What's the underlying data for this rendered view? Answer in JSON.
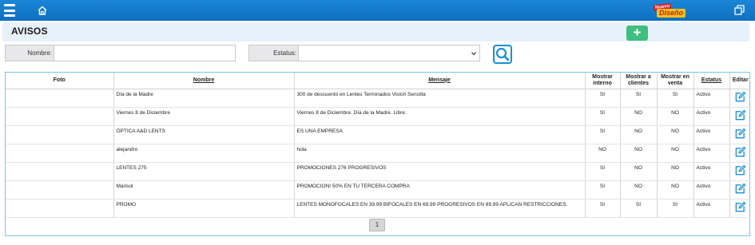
{
  "topbar": {
    "logo_top": "Nuevo",
    "logo_bottom": "Diseño"
  },
  "page": {
    "title": "AVISOS",
    "add_label": "+"
  },
  "filters": {
    "nombre_label": "Nombre:",
    "nombre_value": "",
    "estatus_label": "Estatus:",
    "estatus_value": ""
  },
  "table": {
    "headers": {
      "foto": "Foto",
      "nombre": "Nombre",
      "mensaje": "Mensaje",
      "mostrar_interno": "Mostrar interno",
      "mostrar_clientes": "Mostrar a clientes",
      "mostrar_venta": "Mostrar en venta",
      "estatus": "Estatus",
      "editar": "Editar"
    },
    "rows": [
      {
        "nombre": "Día de la Madre",
        "mensaje": "300 de descuento en Lentes Terminados Vision Sencilla",
        "interno": "SI",
        "clientes": "SI",
        "venta": "SI",
        "estatus": "Activo"
      },
      {
        "nombre": "Viernes 8 de Diciembre",
        "mensaje": "Viernes 8 de Diciembre. Día de la Madre. Libre.",
        "interno": "SI",
        "clientes": "NO",
        "venta": "NO",
        "estatus": "Activo"
      },
      {
        "nombre": "ÓPTICA A&D LENTS",
        "mensaje": "ES UNA EMPRESA",
        "interno": "SI",
        "clientes": "NO",
        "venta": "NO",
        "estatus": "Activo"
      },
      {
        "nombre": "alejandro",
        "mensaje": "hola",
        "interno": "NO",
        "clientes": "NO",
        "venta": "NO",
        "estatus": "Activo"
      },
      {
        "nombre": "LENTES 275",
        "mensaje": "PROMOCIONES 276 PROGRESIVOS",
        "interno": "SI",
        "clientes": "NO",
        "venta": "NO",
        "estatus": "Activo"
      },
      {
        "nombre": "Marisol",
        "mensaje": "PROMOCION! 50% EN TU TERCERA COMPRA",
        "interno": "SI",
        "clientes": "NO",
        "venta": "NO",
        "estatus": "Activo"
      },
      {
        "nombre": "PROMO",
        "mensaje": "LENTES MONOFOCALES EN 39.99 BIFOCALES EN 69.99 PROGRESIVOS EN 89.99 APLICAN RESTRICCIONES.",
        "interno": "SI",
        "clientes": "SI",
        "venta": "SI",
        "estatus": "Activo"
      }
    ]
  },
  "pagination": {
    "current_page": "1"
  },
  "colors": {
    "topbar": "#0e6fc0",
    "title_bg": "#e7f1fa",
    "add_button": "#3fbf7f",
    "accent": "#1a8fd0"
  },
  "icons": [
    "menu-icon",
    "home-icon",
    "restore-window-icon",
    "plus-icon",
    "search-icon",
    "chevron-down-icon",
    "edit-icon"
  ]
}
